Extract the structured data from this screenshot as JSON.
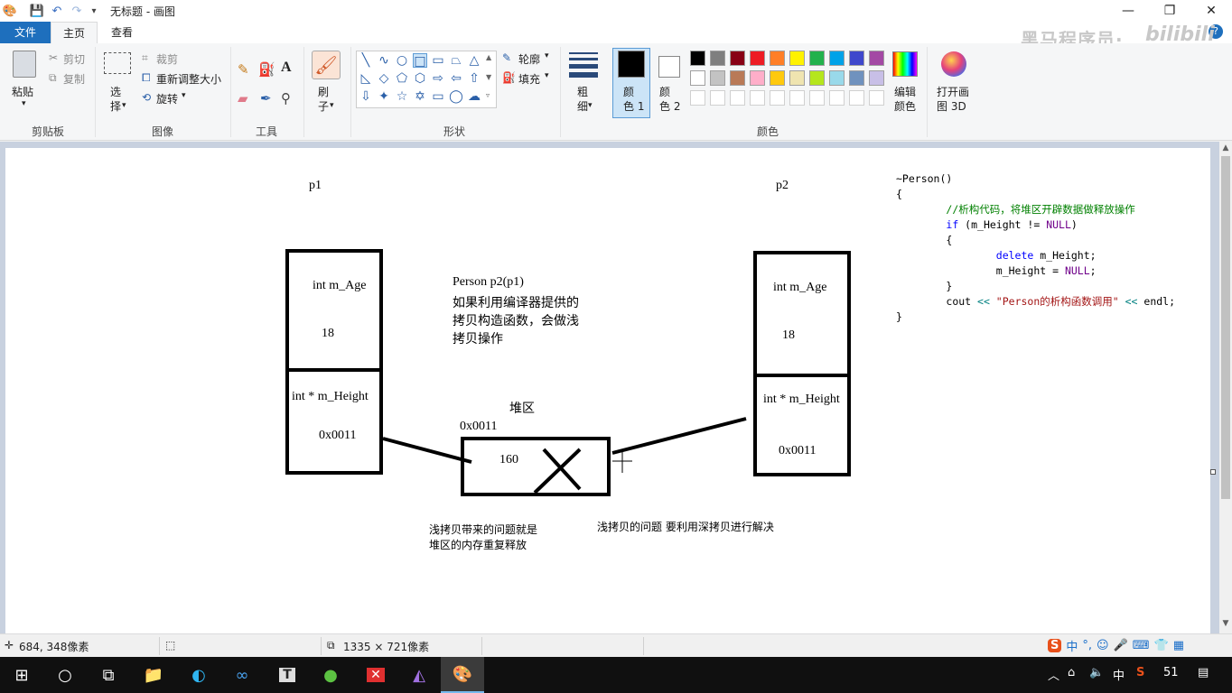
{
  "window": {
    "title": "无标题 - 画图",
    "controls": {
      "minimize": "—",
      "maximize": "❐",
      "close": "✕"
    }
  },
  "tabs": {
    "file": "文件",
    "home": "主页",
    "view": "查看"
  },
  "watermark": {
    "text": "黑马程序员·",
    "logo": "bilibili"
  },
  "ribbon": {
    "clipboard": {
      "group": "剪贴板",
      "paste": "粘贴",
      "cut": "剪切",
      "copy": "复制"
    },
    "image": {
      "group": "图像",
      "select": "选\n择",
      "crop": "裁剪",
      "resize": "重新调整大小",
      "rotate": "旋转"
    },
    "tools": {
      "group": "工具"
    },
    "brush": {
      "label": "刷\n子"
    },
    "shapes": {
      "group": "形状",
      "outline": "轮廓",
      "fill": "填充"
    },
    "size": {
      "label": "粗\n细"
    },
    "colors": {
      "group": "颜色",
      "color1": "颜\n色 1",
      "color2": "颜\n色 2",
      "edit": "编辑\n颜色",
      "paint3d": "打开画\n图 3D",
      "color1_value": "#000000",
      "color2_value": "#ffffff",
      "palette_row1": [
        "#000000",
        "#7f7f7f",
        "#880015",
        "#ed1c24",
        "#ff7f27",
        "#fff200",
        "#22b14c",
        "#00a2e8",
        "#3f48cc",
        "#a349a4"
      ],
      "palette_row2": [
        "#ffffff",
        "#c3c3c3",
        "#b97a57",
        "#ffaec9",
        "#ffc90e",
        "#efe4b0",
        "#b5e61d",
        "#99d9ea",
        "#7092be",
        "#c8bfe7"
      ]
    }
  },
  "canvas": {
    "p1": "p1",
    "p2": "p2",
    "p1_age_label": "int m_Age",
    "p1_age_value": "18",
    "p1_height_label": "int * m_Height",
    "p1_height_value": "0x0011",
    "p2_age_label": "int  m_Age",
    "p2_age_value": "18",
    "p2_height_label": "int * m_Height",
    "p2_height_value": "0x0011",
    "copy_line1": "Person p2(p1)",
    "copy_line2": "如果利用编译器提供的",
    "copy_line3": "拷贝构造函数，会做浅",
    "copy_line4": "拷贝操作",
    "heap_label": "堆区",
    "heap_addr": "0x0011",
    "heap_value": "160",
    "note1_line1": "浅拷贝带来的问题就是",
    "note1_line2": "堆区的内存重复释放",
    "note2": "浅拷贝的问题 要利用深拷贝进行解决",
    "code": {
      "l1": "~Person()",
      "l2": "{",
      "l3": "//析构代码，将堆区开辟数据做释放操作",
      "l4_kw": "if",
      "l4_rest": " (m_Height != ",
      "l4_null": "NULL",
      "l4_end": ")",
      "l5": "{",
      "l6_kw": "delete",
      "l6_rest": " m_Height;",
      "l7_rest": "m_Height = ",
      "l7_null": "NULL",
      "l7_end": ";",
      "l8": "}",
      "l9_a": "cout ",
      "l9_op1": "<<",
      "l9_str": " \"Person的析构函数调用\" ",
      "l9_op2": "<<",
      "l9_b": " endl;",
      "l10": "}"
    }
  },
  "status": {
    "cursor_pos": "684, 348像素",
    "canvas_size": "1335 × 721像素"
  },
  "taskbar": {
    "tray_lang": "中",
    "tray_num": "51",
    "ime_lang": "中"
  }
}
